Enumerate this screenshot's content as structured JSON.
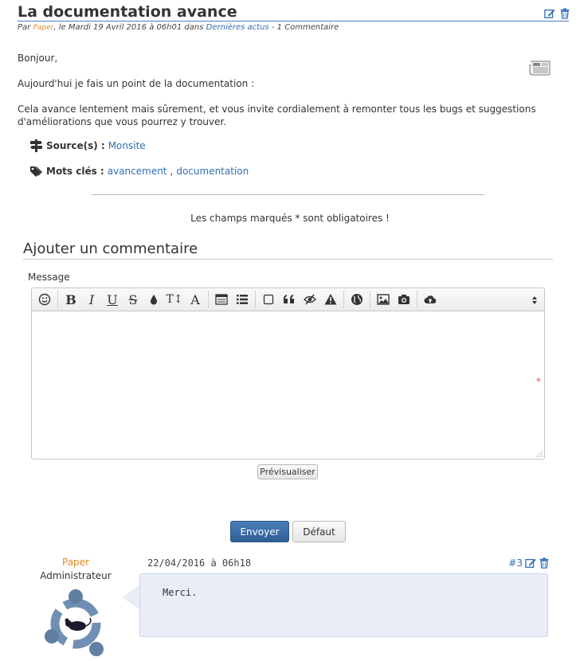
{
  "article": {
    "title": "La documentation avance",
    "meta": {
      "prefix": "Par",
      "author": "Paper",
      "date_text": ", le Mardi 19 Avril 2016 à 06h01 dans",
      "category": "Dernières actus",
      "separator": "-",
      "comments": "1 Commentaire"
    },
    "paragraphs": [
      "Bonjour,",
      "Aujourd'hui je fais un point de la documentation :",
      "Cela avance lentement mais sûrement, et vous invite cordialement à remonter tous les bugs et suggestions d'améliorations que vous pourrez y trouver."
    ],
    "source_label": "Source(s) :",
    "source_link": "Monsite",
    "keywords_label": "Mots clés :",
    "keywords": [
      "avancement",
      "documentation"
    ],
    "keyword_sep": ","
  },
  "form": {
    "required_note": "Les champs marqués * sont obligatoires !",
    "section_title": "Ajouter un commentaire",
    "message_label": "Message",
    "required_star": "*",
    "preview_label": "Prévisualiser",
    "send_label": "Envoyer",
    "default_label": "Défaut",
    "toolbar": {
      "bold": "B",
      "italic": "I",
      "underline": "U",
      "strike": "S",
      "size": "T↕",
      "font": "A"
    }
  },
  "comment": {
    "author": "Paper",
    "role": "Administrateur",
    "date": "22/04/2016 à 06h18",
    "number": "#3",
    "text": "Merci."
  },
  "colors": {
    "link": "#2f6fb3",
    "author": "#e08a2c",
    "send_button": "#2d5f96",
    "bubble": "#e8edf7"
  }
}
